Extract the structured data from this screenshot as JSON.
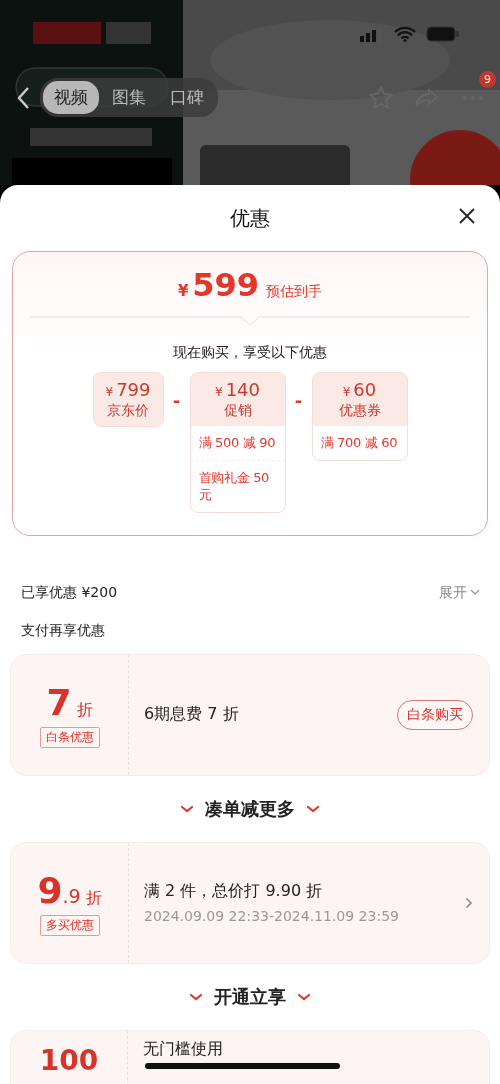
{
  "media_tabs": [
    {
      "label": "视频",
      "selected": true
    },
    {
      "label": "图集",
      "selected": false
    },
    {
      "label": "口碑",
      "selected": false
    }
  ],
  "more_badge": "9",
  "sheet": {
    "title": "优惠"
  },
  "summary": {
    "currency": "¥",
    "price": "599",
    "price_note": "预估到手",
    "subtitle": "现在购买，享受以下优惠",
    "items": [
      {
        "currency": "¥",
        "amount": "799",
        "label": "京东价"
      },
      {
        "operator": "-",
        "currency": "¥",
        "amount": "140",
        "label": "促销",
        "details": [
          "满 500 减 90",
          "首购礼金 50元"
        ]
      },
      {
        "operator": "-",
        "currency": "¥",
        "amount": "60",
        "label": "优惠券",
        "details": [
          "满 700 减 60"
        ]
      }
    ]
  },
  "enjoyed": {
    "label": "已享优惠 ¥200",
    "toggle": "展开"
  },
  "pay_heading": "支付再享优惠",
  "sections": [
    {
      "cards": [
        {
          "value": "7",
          "unit": "折",
          "tag": "白条优惠",
          "title": "6期息费 7 折",
          "action": {
            "kind": "button",
            "label": "白条购买"
          }
        }
      ]
    },
    {
      "heading": "凑单减更多",
      "cards": [
        {
          "value": "9",
          "decimal": ".9",
          "unit": "折",
          "tag": "多买优惠",
          "title": "满 2 件，总价打 9.90 折",
          "subtitle": "2024.09.09 22:33-2024.11.09 23:59",
          "action": {
            "kind": "chevron"
          }
        }
      ]
    },
    {
      "heading": "开通立享",
      "cards": [
        {
          "value": "100",
          "title": "无门槛使用"
        }
      ]
    }
  ]
}
